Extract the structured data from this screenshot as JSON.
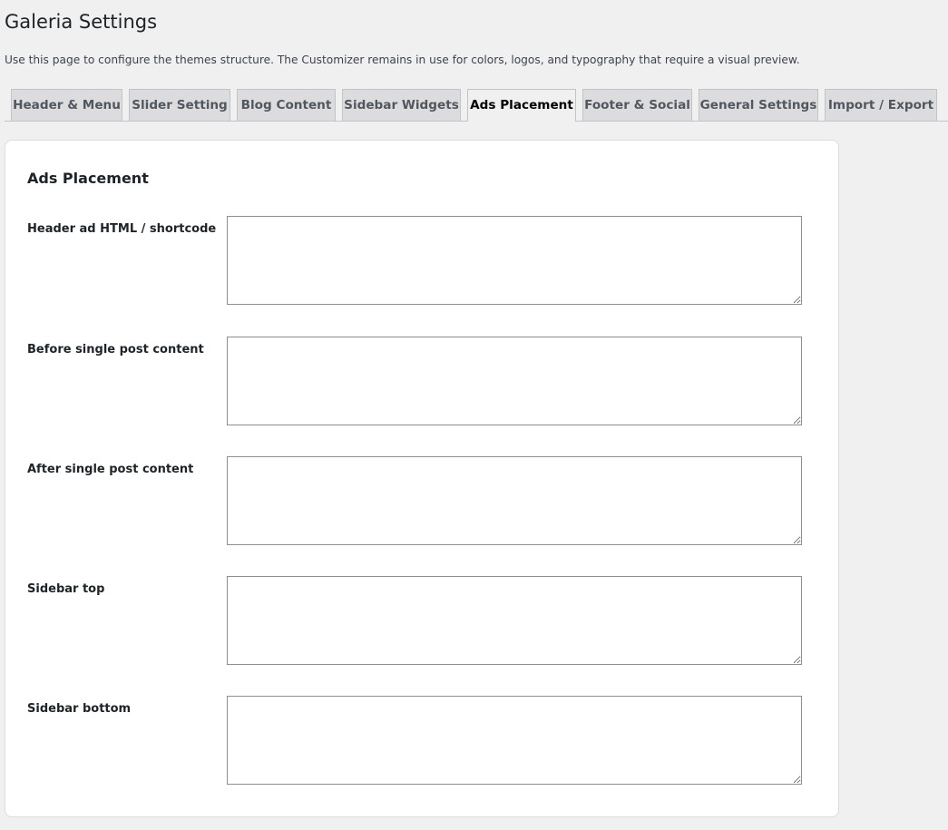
{
  "page": {
    "title": "Galeria Settings",
    "description": "Use this page to configure the themes structure. The Customizer remains in use for colors, logos, and typography that require a visual preview."
  },
  "tabs": [
    {
      "label": "Header & Menu",
      "active": false
    },
    {
      "label": "Slider Setting",
      "active": false
    },
    {
      "label": "Blog Content",
      "active": false
    },
    {
      "label": "Sidebar Widgets",
      "active": false
    },
    {
      "label": "Ads Placement",
      "active": true
    },
    {
      "label": "Footer & Social",
      "active": false
    },
    {
      "label": "General Settings",
      "active": false
    },
    {
      "label": "Import / Export",
      "active": false
    }
  ],
  "section": {
    "title": "Ads Placement",
    "fields": [
      {
        "label": "Header ad HTML / shortcode",
        "value": ""
      },
      {
        "label": "Before single post content",
        "value": ""
      },
      {
        "label": "After single post content",
        "value": ""
      },
      {
        "label": "Sidebar top",
        "value": ""
      },
      {
        "label": "Sidebar bottom",
        "value": ""
      }
    ]
  },
  "colors": {
    "page_background": "#f0f0f1",
    "panel_background": "#ffffff",
    "tab_inactive": "#dcdcde",
    "border": "#c3c4c7",
    "input_border": "#8c8f94"
  }
}
